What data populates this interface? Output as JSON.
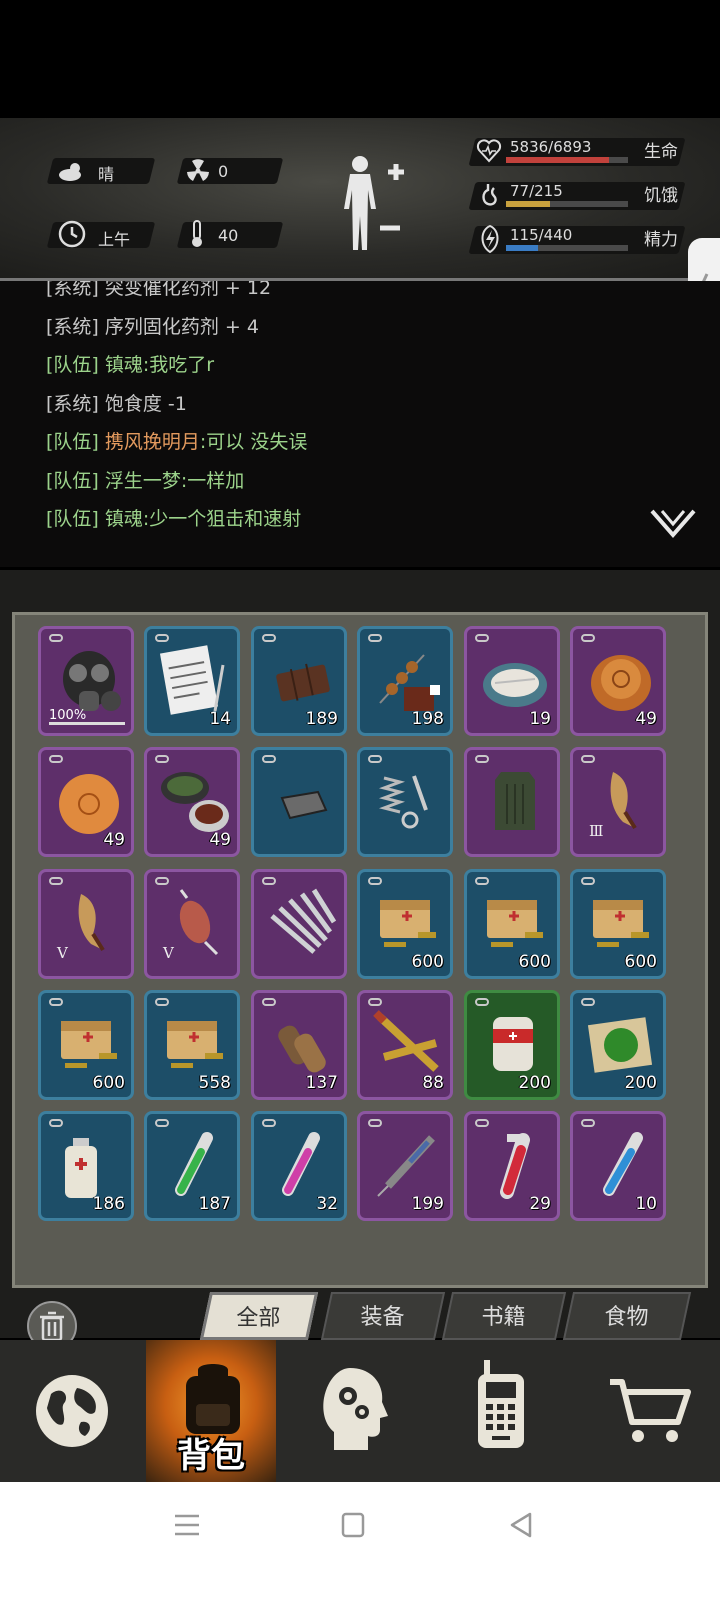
{
  "status": {
    "weather": {
      "icon": "cloud-sun-icon",
      "label": "晴"
    },
    "radiation": {
      "icon": "radiation-icon",
      "value": "0"
    },
    "time": {
      "icon": "clock-icon",
      "label": "上午"
    },
    "temperature": {
      "icon": "thermometer-icon",
      "value": "40"
    },
    "stats": [
      {
        "icon": "heart-icon",
        "text": "5836/6893",
        "label": "生命",
        "fraction": 0.847,
        "color": "#c2423c"
      },
      {
        "icon": "stomach-icon",
        "text": "77/215",
        "label": "饥饿",
        "fraction": 0.358,
        "color": "#c8a13e"
      },
      {
        "icon": "energy-icon",
        "text": "115/440",
        "label": "精力",
        "fraction": 0.261,
        "color": "#3a7cc4"
      }
    ]
  },
  "chat": {
    "lines": [
      {
        "tag": "[系统]",
        "name": "",
        "text": "突变催化药剂 + 12",
        "type": "system"
      },
      {
        "tag": "[系统]",
        "name": "",
        "text": "序列固化药剂 + 4",
        "type": "system"
      },
      {
        "tag": "[队伍]",
        "name": "镇魂",
        "text": ":我吃了r",
        "type": "team"
      },
      {
        "tag": "[系统]",
        "name": "",
        "text": "饱食度 -1",
        "type": "system"
      },
      {
        "tag": "[队伍]",
        "name": "携风挽明月",
        "text": ":可以 没失误",
        "type": "team-orange"
      },
      {
        "tag": "[队伍]",
        "name": "浮生一梦",
        "text": ":一样加",
        "type": "team"
      },
      {
        "tag": "[队伍]",
        "name": "镇魂",
        "text": ":少一个狙击和速射",
        "type": "team"
      }
    ]
  },
  "inventory": {
    "rows": [
      [
        {
          "item": "gas-mask-icon",
          "rarity": "purple",
          "count": "",
          "durability": "100%"
        },
        {
          "item": "notebook-icon",
          "rarity": "blue",
          "count": "14"
        },
        {
          "item": "chocolate-icon",
          "rarity": "blue",
          "count": "189"
        },
        {
          "item": "skewer-icon",
          "rarity": "blue",
          "count": "198",
          "locked": true
        },
        {
          "item": "fish-plate-icon",
          "rarity": "purple",
          "count": "19"
        },
        {
          "item": "mooncake-icon",
          "rarity": "purple",
          "count": "49"
        }
      ],
      [
        {
          "item": "pastry-icon",
          "rarity": "purple",
          "count": "49"
        },
        {
          "item": "hotpot-icon",
          "rarity": "purple",
          "count": "49"
        },
        {
          "item": "metal-bar-icon",
          "rarity": "blue",
          "count": ""
        },
        {
          "item": "spring-screw-icon",
          "rarity": "blue",
          "count": ""
        },
        {
          "item": "armor-vest-icon",
          "rarity": "purple",
          "count": ""
        },
        {
          "item": "claw-icon",
          "rarity": "purple",
          "count": "",
          "tier": "Ⅲ"
        }
      ],
      [
        {
          "item": "claw-icon",
          "rarity": "purple",
          "count": "",
          "tier": "Ⅴ"
        },
        {
          "item": "meat-icon",
          "rarity": "purple",
          "count": "",
          "tier": "Ⅴ"
        },
        {
          "item": "steel-rods-icon",
          "rarity": "purple",
          "count": ""
        },
        {
          "item": "ammo-box-icon",
          "rarity": "blue",
          "count": "600"
        },
        {
          "item": "ammo-box-icon",
          "rarity": "blue",
          "count": "600"
        },
        {
          "item": "ammo-box-icon",
          "rarity": "blue",
          "count": "600"
        }
      ],
      [
        {
          "item": "ammo-box-icon",
          "rarity": "blue",
          "count": "600"
        },
        {
          "item": "ammo-box-icon",
          "rarity": "blue",
          "count": "558"
        },
        {
          "item": "shotgun-shell-icon",
          "rarity": "purple",
          "count": "137"
        },
        {
          "item": "rifle-bullet-icon",
          "rarity": "purple",
          "count": "88"
        },
        {
          "item": "bandage-icon",
          "rarity": "green",
          "count": "200"
        },
        {
          "item": "herb-icon",
          "rarity": "blue",
          "count": "200"
        }
      ],
      [
        {
          "item": "spray-can-icon",
          "rarity": "blue",
          "count": "186"
        },
        {
          "item": "green-vial-icon",
          "rarity": "blue",
          "count": "187"
        },
        {
          "item": "pink-vial-icon",
          "rarity": "blue",
          "count": "32"
        },
        {
          "item": "syringe-icon",
          "rarity": "purple",
          "count": "199"
        },
        {
          "item": "red-vial-icon",
          "rarity": "purple",
          "count": "29"
        },
        {
          "item": "blue-vial-icon",
          "rarity": "purple",
          "count": "10"
        }
      ]
    ]
  },
  "tabs": [
    {
      "label": "全部",
      "active": true
    },
    {
      "label": "装备",
      "active": false
    },
    {
      "label": "书籍",
      "active": false
    },
    {
      "label": "食物",
      "active": false
    }
  ],
  "nav": {
    "backpack_label": "背包",
    "items": [
      "globe-icon",
      "backpack-icon",
      "brain-head-icon",
      "radio-icon",
      "cart-icon"
    ]
  },
  "colors": {
    "purple": "#5e2f6a",
    "blue": "#1d4e68",
    "green": "#255a27",
    "chat_team": "#9cd38b",
    "chat_orange": "#e39a5e"
  }
}
